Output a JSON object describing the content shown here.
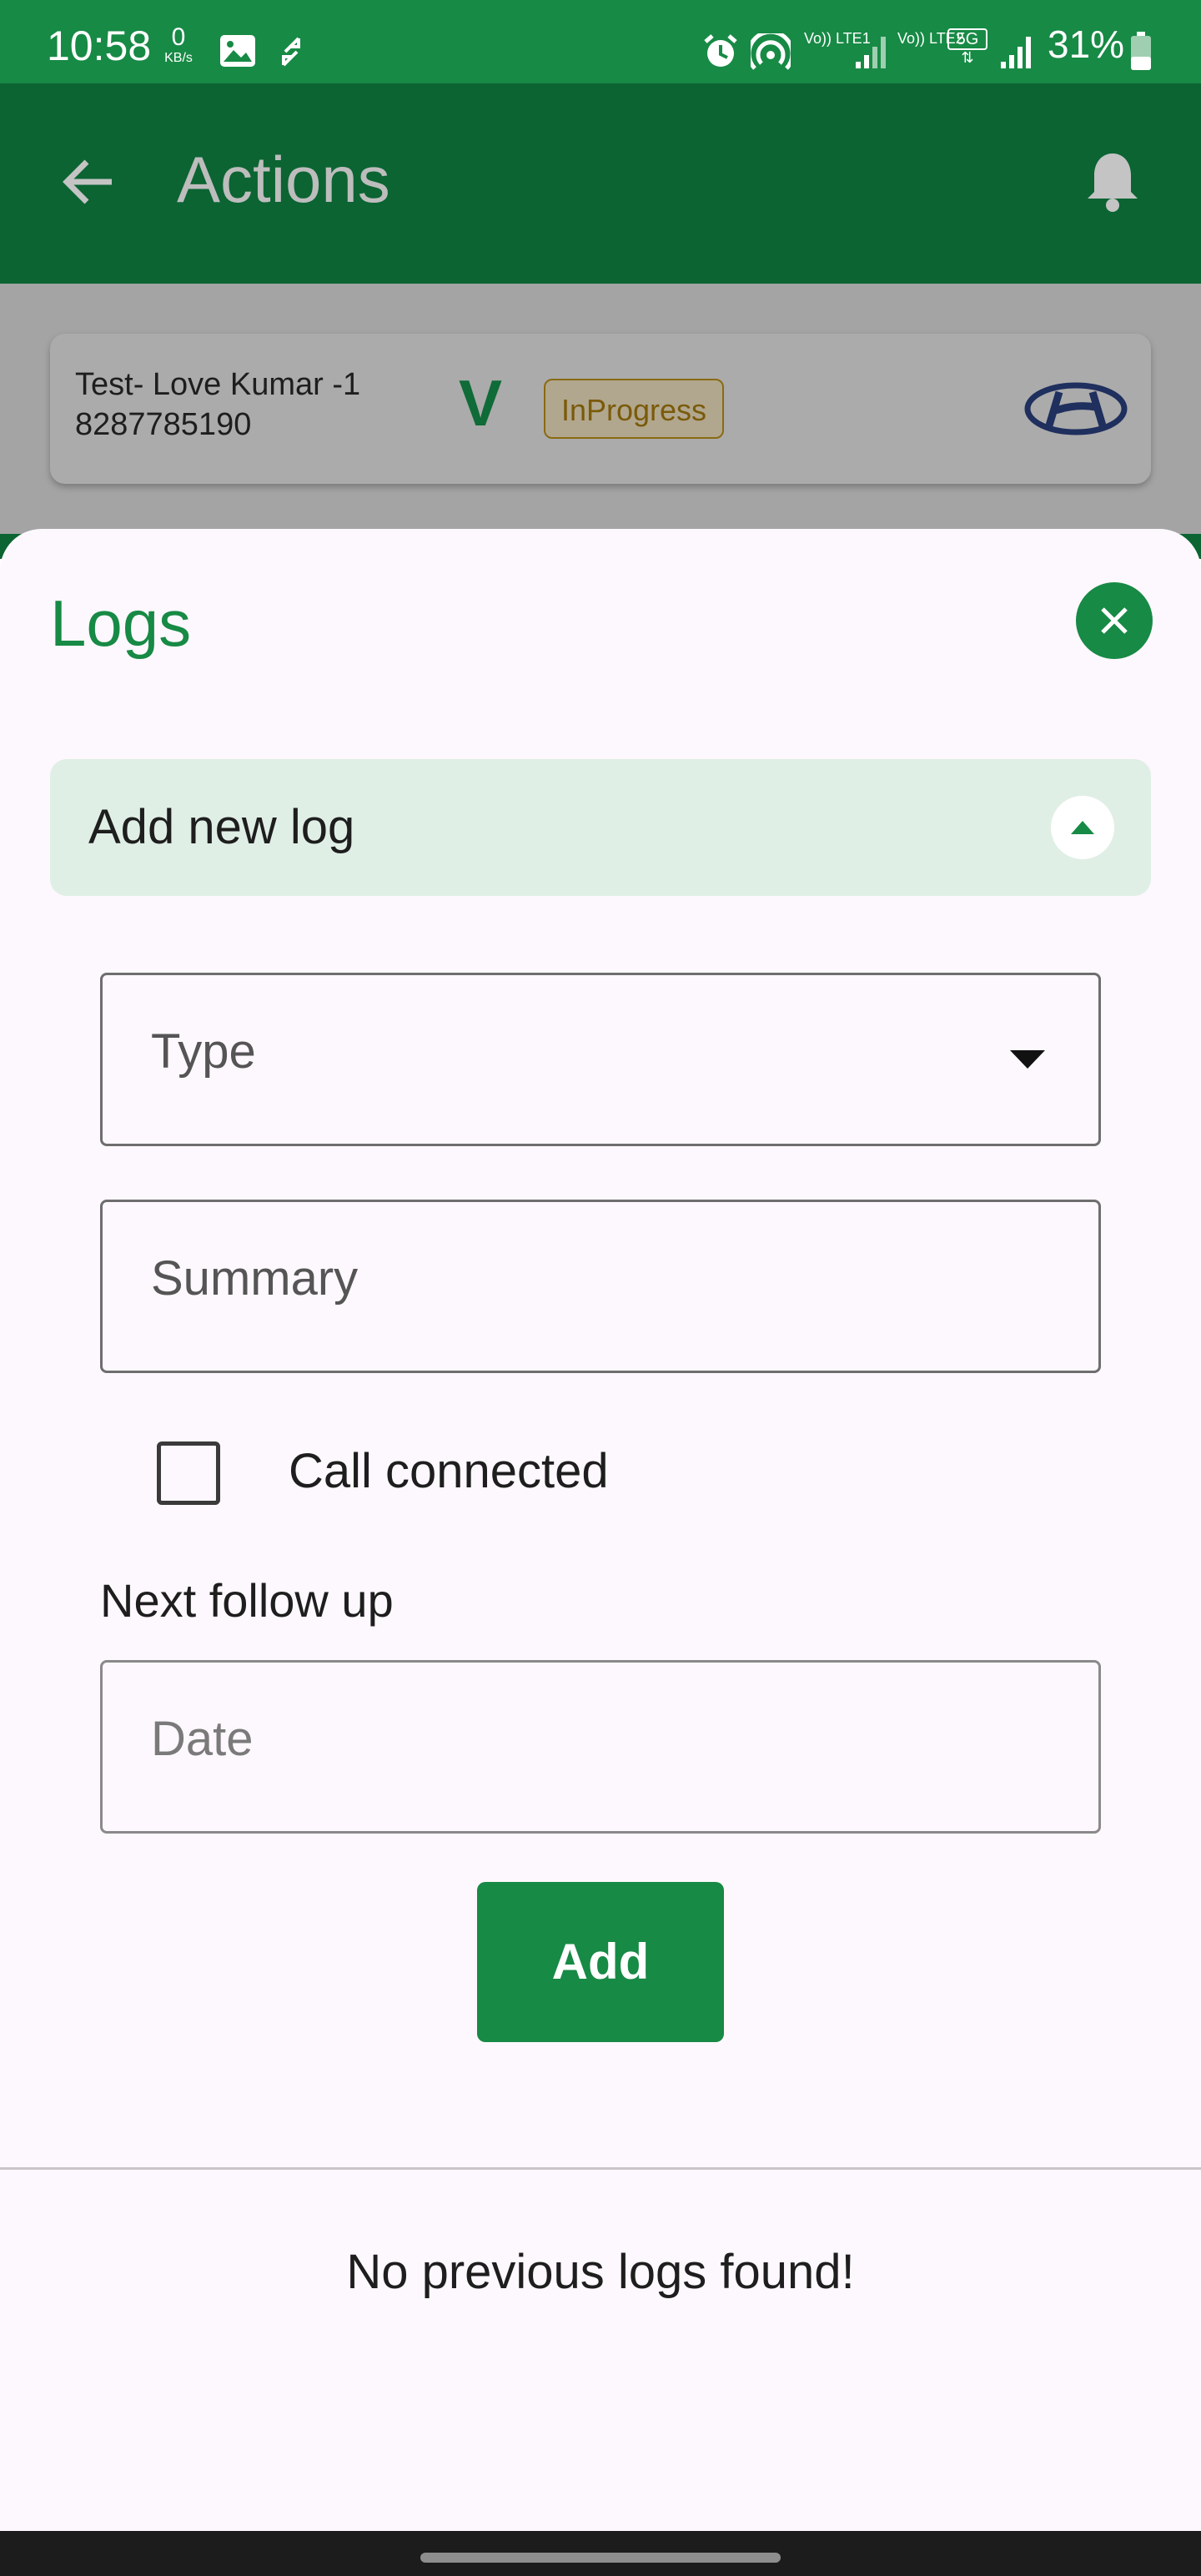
{
  "status_bar": {
    "time": "10:58",
    "data_rate": "0",
    "data_rate_unit": "KB/s",
    "sim1_label": "Vo)) LTE1",
    "sim2_label": "Vo)) LTE2",
    "network_type": "5G",
    "battery": "31%"
  },
  "app_bar": {
    "title": "Actions"
  },
  "lead_card": {
    "name": "Test- Love Kumar -1",
    "phone": "8287785190",
    "badge_letter": "V",
    "status": "InProgress"
  },
  "sheet": {
    "title": "Logs",
    "accordion_title": "Add new log",
    "type_placeholder": "Type",
    "summary_placeholder": "Summary",
    "call_connected_label": "Call connected",
    "call_connected_checked": false,
    "next_follow_up_label": "Next follow up",
    "date_placeholder": "Date",
    "add_button_label": "Add",
    "empty_message": "No previous logs found!"
  },
  "colors": {
    "primary": "#178a45",
    "primary_dark": "#0b6432",
    "accordion_bg": "#e0efe6",
    "sheet_bg": "#fdf8fd"
  }
}
